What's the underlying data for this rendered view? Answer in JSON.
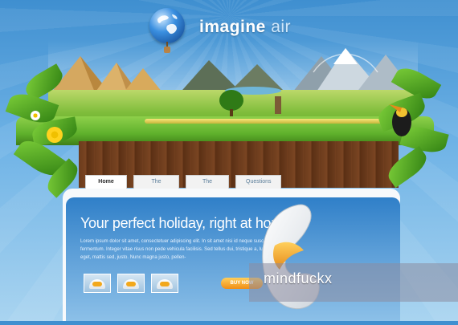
{
  "brand": {
    "logo_main": "imagine",
    "logo_accent": "air"
  },
  "nav": {
    "tabs": [
      {
        "label": "Home",
        "active": true
      },
      {
        "label": "The Couch"
      },
      {
        "label": "The Trips"
      },
      {
        "label": "Questions ?"
      }
    ]
  },
  "hero": {
    "title": "Your perfect holiday, right at home..",
    "body": "Lorem ipsum dolor sit amet, consectetuer adipiscing elit. In sit amet nisi id neque suscipit fermentum. Integer vitae risus non pede vehicula facilisis. Sed tellus dui, tristique a, luctus eget, mattis sed, justo. Nunc magna justo, pellen-",
    "cta": "BUY NOW"
  },
  "watermark": {
    "text": "mindfuckx"
  },
  "colors": {
    "sky": "#3f8fd0",
    "accent": "#f08e16",
    "hero": "#2f7fc8"
  }
}
